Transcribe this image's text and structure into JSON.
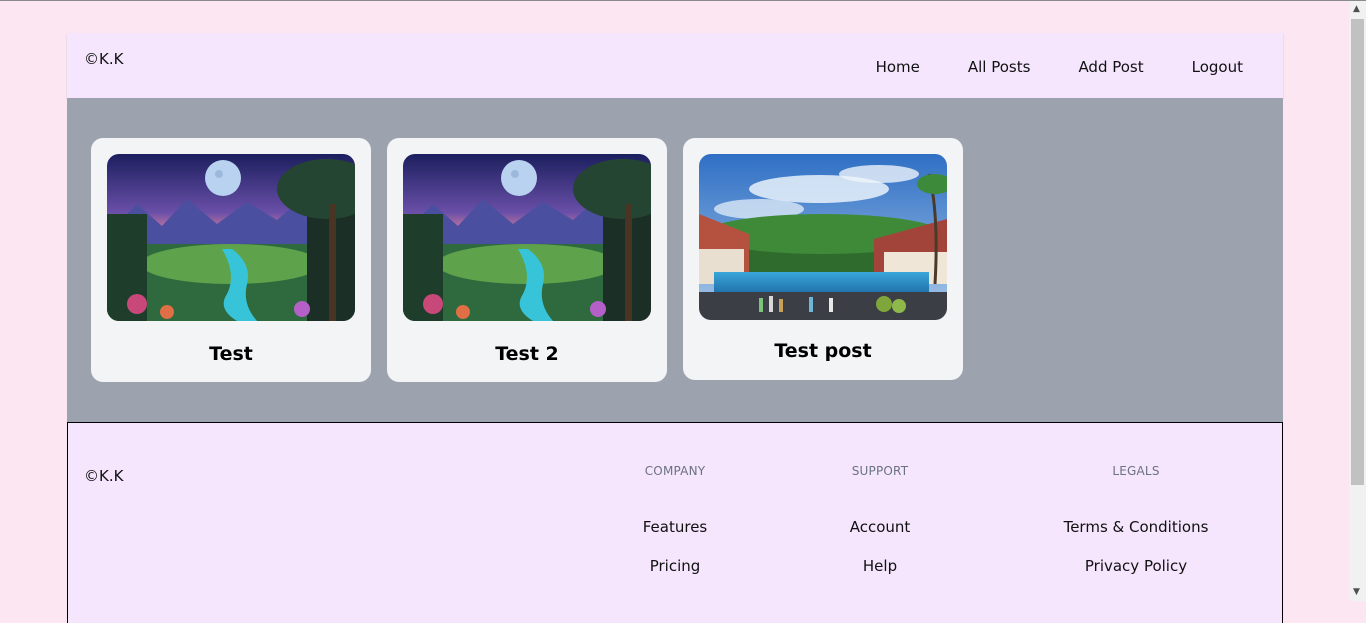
{
  "header": {
    "brand": "©K.K",
    "nav": [
      "Home",
      "All Posts",
      "Add Post",
      "Logout"
    ]
  },
  "posts": [
    {
      "title": "Test",
      "image": "fantasy-moon-landscape"
    },
    {
      "title": "Test 2",
      "image": "fantasy-moon-landscape"
    },
    {
      "title": "Test post",
      "image": "tropical-resort-pool"
    }
  ],
  "footer": {
    "brand": "©K.K",
    "columns": [
      {
        "heading": "COMPANY",
        "links": [
          "Features",
          "Pricing"
        ]
      },
      {
        "heading": "SUPPORT",
        "links": [
          "Account",
          "Help"
        ]
      },
      {
        "heading": "LEGALS",
        "links": [
          "Terms & Conditions",
          "Privacy Policy"
        ]
      }
    ]
  },
  "colors": {
    "page_bg": "#fce6f1",
    "header_bg": "#f5e6fd",
    "main_bg": "#9ca3af",
    "card_bg": "#f3f4f6"
  }
}
